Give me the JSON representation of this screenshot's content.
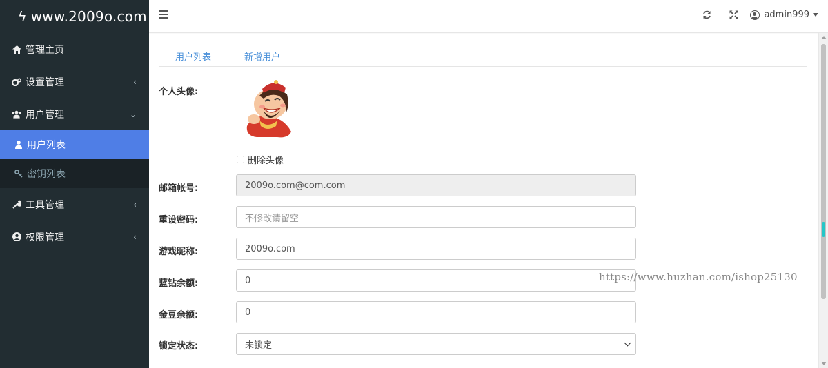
{
  "brand": {
    "icon": "bolt-icon",
    "title": "www.2009o.com"
  },
  "sidebar": {
    "items": [
      {
        "label": "管理主页",
        "icon": "home-icon"
      },
      {
        "label": "设置管理",
        "icon": "cogs-icon",
        "chevron": "‹"
      },
      {
        "label": "用户管理",
        "icon": "users-icon",
        "chevron": "⌄"
      },
      {
        "label": "工具管理",
        "icon": "wrench-icon",
        "chevron": "‹"
      },
      {
        "label": "权限管理",
        "icon": "user-circle-icon",
        "chevron": "‹"
      }
    ],
    "submenu": [
      {
        "label": "用户列表",
        "icon": "user-icon",
        "active": true
      },
      {
        "label": "密钥列表",
        "icon": "key-icon",
        "active": false
      }
    ]
  },
  "topbar": {
    "refresh_icon": "refresh-icon",
    "fullscreen_icon": "expand-icon",
    "username": "admin999"
  },
  "tabs": [
    {
      "label": "用户列表"
    },
    {
      "label": "新增用户"
    }
  ],
  "form": {
    "avatar_label": "个人头像:",
    "delete_avatar_label": "删除头像",
    "email_label": "邮箱帐号:",
    "email_value": "2009o.com@com.com",
    "password_label": "重设密码:",
    "password_placeholder": "不修改请留空",
    "nickname_label": "游戏昵称:",
    "nickname_value": "2009o.com",
    "diamond_label": "蓝钻余额:",
    "diamond_value": "0",
    "gold_label": "金豆余额:",
    "gold_value": "0",
    "lock_label": "锁定状态:",
    "lock_value": "未锁定"
  },
  "watermark": "https://www.huzhan.com/ishop25130",
  "colors": {
    "sidebar_bg": "#222d32",
    "active_item": "#4f7ee6",
    "tab_link": "#4a90d9",
    "scroll_accent": "#24c6c8"
  }
}
